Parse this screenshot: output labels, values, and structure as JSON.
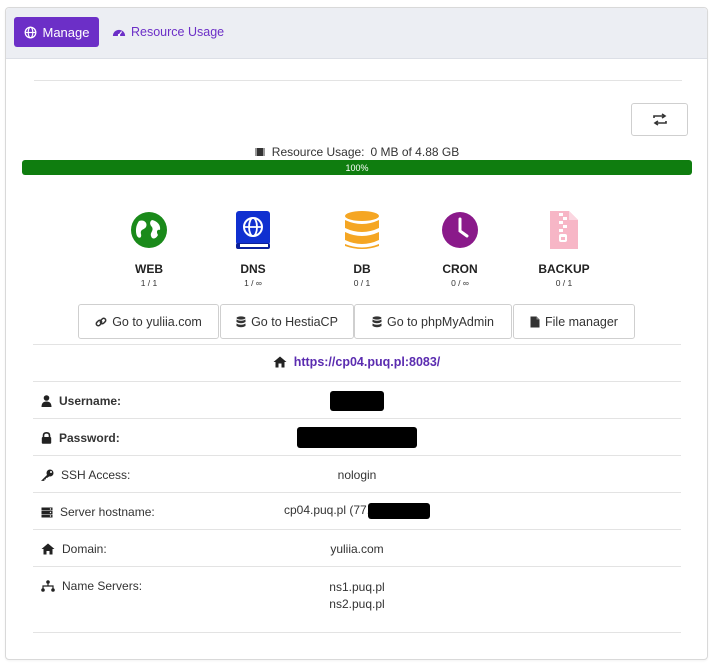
{
  "tabs": {
    "manage_label": "Manage",
    "resource_usage_label": "Resource Usage"
  },
  "usage": {
    "label": "Resource Usage:",
    "value": "0 MB of 4.88 GB",
    "progress_text": "100%",
    "progress_fraction": 1.0,
    "progress_color": "#0f7d0f"
  },
  "services": [
    {
      "name": "WEB",
      "count": "1 / 1",
      "icon": "globe-icon",
      "color": "#1a8a1a"
    },
    {
      "name": "DNS",
      "count": "1 / ∞",
      "icon": "dns-book-icon",
      "color": "#1030d0"
    },
    {
      "name": "DB",
      "count": "0 / 1",
      "icon": "database-icon",
      "color": "#f5a623"
    },
    {
      "name": "CRON",
      "count": "0 / ∞",
      "icon": "clock-icon",
      "color": "#8a1a8a"
    },
    {
      "name": "BACKUP",
      "count": "0 / 1",
      "icon": "file-zipper-icon",
      "color": "#f7b6c6"
    }
  ],
  "buttons": {
    "go_site": "Go to yuliia.com",
    "go_hestia": "Go to HestiaCP",
    "go_pma": "Go to phpMyAdmin",
    "file_manager": "File manager"
  },
  "panel_url": "https://cp04.puq.pl:8083/",
  "details": {
    "username_label": "Username:",
    "password_label": "Password:",
    "ssh_label": "SSH Access:",
    "ssh_value": "nologin",
    "hostname_label": "Server hostname:",
    "hostname_value": "cp04.puq.pl (77.",
    "domain_label": "Domain:",
    "domain_value": "yuliia.com",
    "ns_label": "Name Servers:",
    "ns1": "ns1.puq.pl",
    "ns2": "ns2.puq.pl"
  },
  "colors": {
    "accent": "#6c2fc7",
    "link": "#5b2cb0"
  }
}
